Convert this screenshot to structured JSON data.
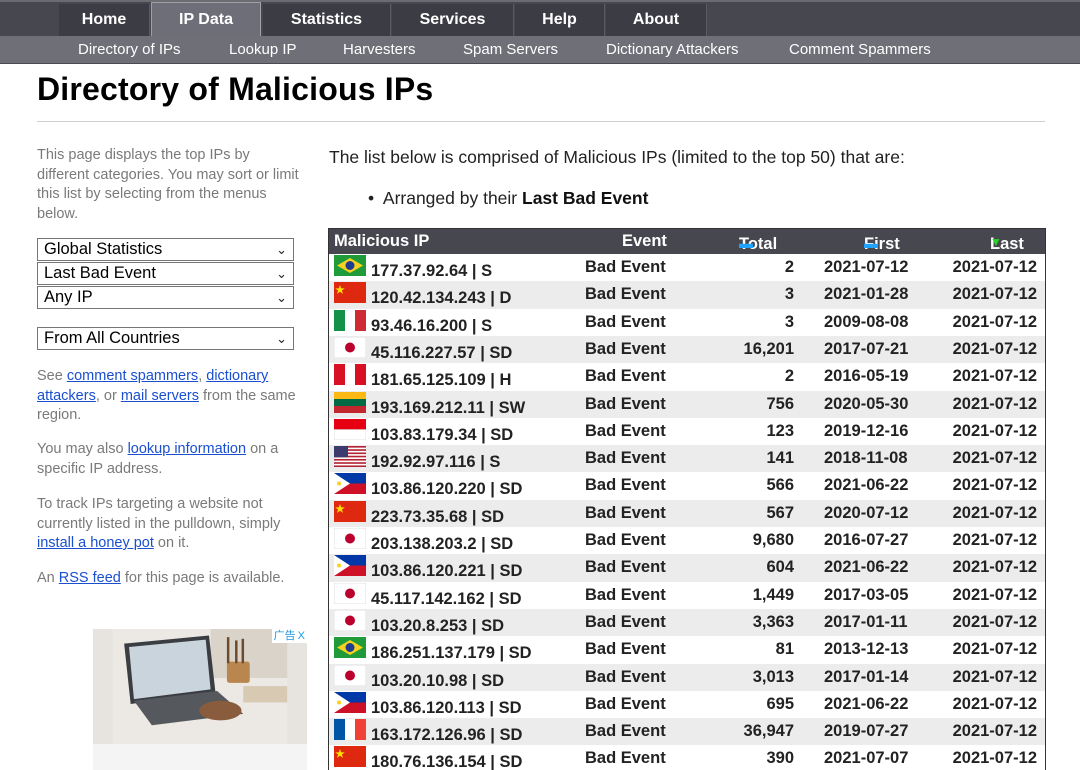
{
  "nav": {
    "tabs": [
      "Home",
      "IP Data",
      "Statistics",
      "Services",
      "Help",
      "About"
    ],
    "active": "IP Data",
    "subtabs": [
      "Directory of IPs",
      "Lookup IP",
      "Harvesters",
      "Spam Servers",
      "Dictionary Attackers",
      "Comment Spammers"
    ]
  },
  "page_title": "Directory of Malicious IPs",
  "sidebar": {
    "intro": "This page displays the top IPs by different categories. You may sort or limit this list by selecting from the menus below.",
    "selects": [
      "Global Statistics",
      "Last Bad Event",
      "Any IP",
      "From All Countries"
    ],
    "see_prefix": "See ",
    "see_link1": "comment spammers",
    "see_sep1": ", ",
    "see_link2": "dictionary attackers",
    "see_sep2": ", or ",
    "see_link3": "mail servers",
    "see_suffix": " from the same region.",
    "lookup_prefix": "You may also ",
    "lookup_link": "lookup information",
    "lookup_suffix": " on a specific IP address.",
    "track_prefix": "To track IPs targeting a website not currently listed in the pulldown, simply ",
    "track_link": "install a honey pot",
    "track_suffix": " on it.",
    "rss_prefix": "An ",
    "rss_link": "RSS feed",
    "rss_suffix": " for this page is available.",
    "ad_label": "广告",
    "ad_close": "X"
  },
  "intro": "The list below is comprised of Malicious IPs (limited to the top 50) that are:",
  "bullet_prefix": "Arranged by their ",
  "bullet_bold": "Last Bad Event",
  "table": {
    "headers": {
      "ip": "Malicious IP",
      "event": "Event",
      "total": "Total",
      "first": "First",
      "last": "Last"
    },
    "colors": {
      "sort_asc": "#1fa3ff",
      "sort_active": "#28d228",
      "header_bg": "#474750"
    },
    "rows": [
      {
        "flag": "brazil",
        "ip": "177.37.92.64 | S",
        "event": "Bad Event",
        "total": "2",
        "first": "2021-07-12",
        "last": "2021-07-12"
      },
      {
        "flag": "china",
        "ip": "120.42.134.243 | D",
        "event": "Bad Event",
        "total": "3",
        "first": "2021-01-28",
        "last": "2021-07-12"
      },
      {
        "flag": "italy",
        "ip": "93.46.16.200 | S",
        "event": "Bad Event",
        "total": "3",
        "first": "2009-08-08",
        "last": "2021-07-12"
      },
      {
        "flag": "japan",
        "ip": "45.116.227.57 | SD",
        "event": "Bad Event",
        "total": "16,201",
        "first": "2017-07-21",
        "last": "2021-07-12"
      },
      {
        "flag": "peru",
        "ip": "181.65.125.109 | H",
        "event": "Bad Event",
        "total": "2",
        "first": "2016-05-19",
        "last": "2021-07-12"
      },
      {
        "flag": "lithuania",
        "ip": "193.169.212.11 | SW",
        "event": "Bad Event",
        "total": "756",
        "first": "2020-05-30",
        "last": "2021-07-12"
      },
      {
        "flag": "indonesia",
        "ip": "103.83.179.34 | SD",
        "event": "Bad Event",
        "total": "123",
        "first": "2019-12-16",
        "last": "2021-07-12"
      },
      {
        "flag": "usa",
        "ip": "192.92.97.116 | S",
        "event": "Bad Event",
        "total": "141",
        "first": "2018-11-08",
        "last": "2021-07-12"
      },
      {
        "flag": "philippines",
        "ip": "103.86.120.220 | SD",
        "event": "Bad Event",
        "total": "566",
        "first": "2021-06-22",
        "last": "2021-07-12"
      },
      {
        "flag": "china",
        "ip": "223.73.35.68 | SD",
        "event": "Bad Event",
        "total": "567",
        "first": "2020-07-12",
        "last": "2021-07-12"
      },
      {
        "flag": "japan",
        "ip": "203.138.203.2 | SD",
        "event": "Bad Event",
        "total": "9,680",
        "first": "2016-07-27",
        "last": "2021-07-12"
      },
      {
        "flag": "philippines",
        "ip": "103.86.120.221 | SD",
        "event": "Bad Event",
        "total": "604",
        "first": "2021-06-22",
        "last": "2021-07-12"
      },
      {
        "flag": "japan",
        "ip": "45.117.142.162 | SD",
        "event": "Bad Event",
        "total": "1,449",
        "first": "2017-03-05",
        "last": "2021-07-12"
      },
      {
        "flag": "japan",
        "ip": "103.20.8.253 | SD",
        "event": "Bad Event",
        "total": "3,363",
        "first": "2017-01-11",
        "last": "2021-07-12"
      },
      {
        "flag": "brazil",
        "ip": "186.251.137.179 | SD",
        "event": "Bad Event",
        "total": "81",
        "first": "2013-12-13",
        "last": "2021-07-12"
      },
      {
        "flag": "japan",
        "ip": "103.20.10.98 | SD",
        "event": "Bad Event",
        "total": "3,013",
        "first": "2017-01-14",
        "last": "2021-07-12"
      },
      {
        "flag": "philippines",
        "ip": "103.86.120.113 | SD",
        "event": "Bad Event",
        "total": "695",
        "first": "2021-06-22",
        "last": "2021-07-12"
      },
      {
        "flag": "france",
        "ip": "163.172.126.96 | SD",
        "event": "Bad Event",
        "total": "36,947",
        "first": "2019-07-27",
        "last": "2021-07-12"
      },
      {
        "flag": "china",
        "ip": "180.76.136.154 | SD",
        "event": "Bad Event",
        "total": "390",
        "first": "2021-07-07",
        "last": "2021-07-12"
      }
    ]
  }
}
